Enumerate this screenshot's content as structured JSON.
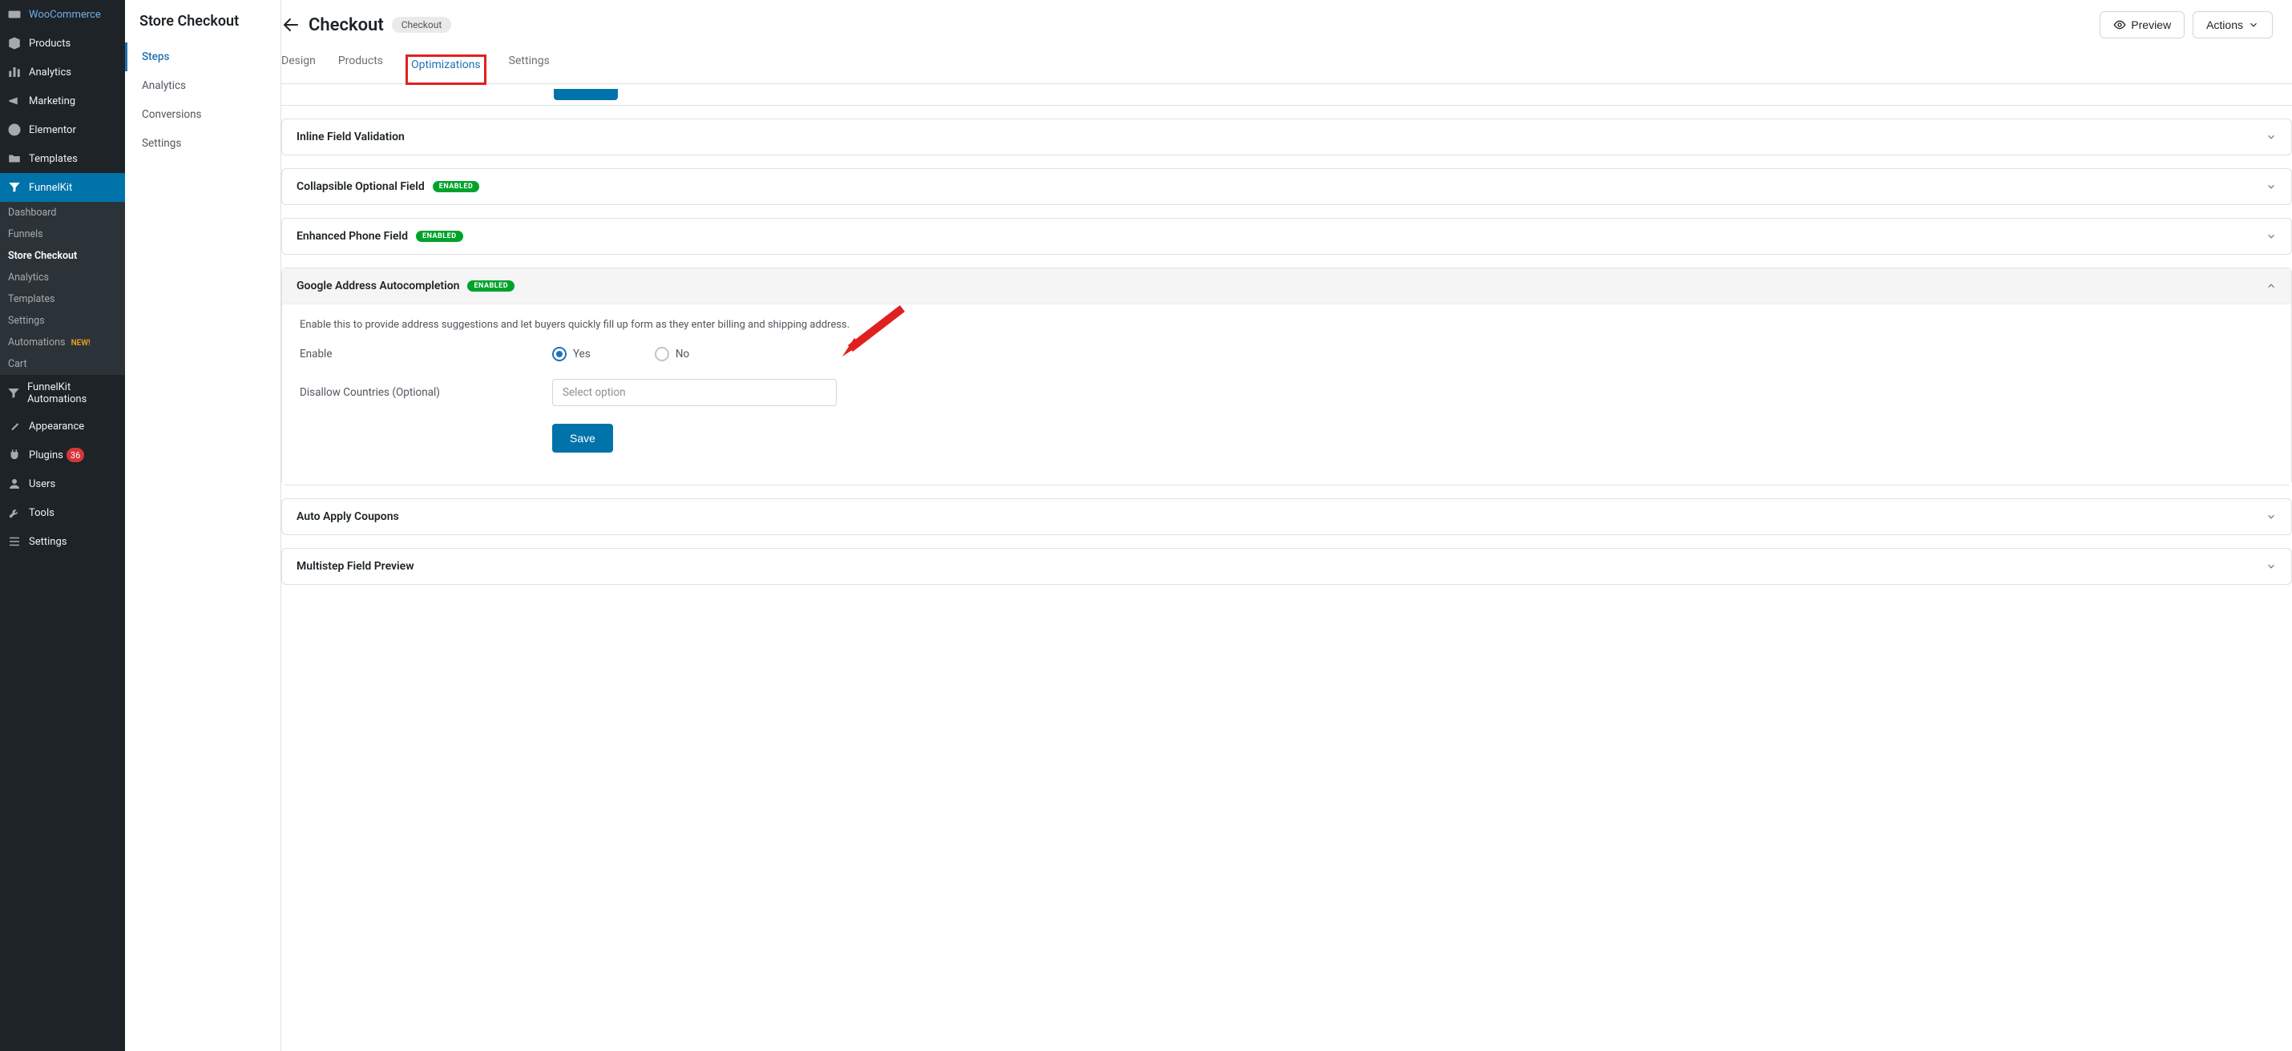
{
  "wpSidebar": {
    "items": [
      {
        "label": "WooCommerce",
        "icon": "woo"
      },
      {
        "label": "Products",
        "icon": "box"
      },
      {
        "label": "Analytics",
        "icon": "bars"
      },
      {
        "label": "Marketing",
        "icon": "megaphone"
      },
      {
        "label": "Elementor",
        "icon": "elementor"
      },
      {
        "label": "Templates",
        "icon": "folder"
      }
    ],
    "funnelkit": {
      "label": "FunnelKit",
      "sub": [
        {
          "label": "Dashboard"
        },
        {
          "label": "Funnels"
        },
        {
          "label": "Store Checkout",
          "current": true
        },
        {
          "label": "Analytics"
        },
        {
          "label": "Templates"
        },
        {
          "label": "Settings"
        },
        {
          "label": "Automations",
          "badge": "NEW!"
        },
        {
          "label": "Cart"
        }
      ]
    },
    "automations": {
      "label": "FunnelKit Automations"
    },
    "bottom": [
      {
        "label": "Appearance",
        "icon": "brush"
      },
      {
        "label": "Plugins",
        "icon": "plug",
        "count": "36"
      },
      {
        "label": "Users",
        "icon": "user"
      },
      {
        "label": "Tools",
        "icon": "wrench"
      },
      {
        "label": "Settings",
        "icon": "sliders"
      }
    ]
  },
  "secondarySidebar": {
    "title": "Store Checkout",
    "items": [
      {
        "label": "Steps",
        "active": true
      },
      {
        "label": "Analytics"
      },
      {
        "label": "Conversions"
      },
      {
        "label": "Settings"
      }
    ]
  },
  "topbar": {
    "title": "Checkout",
    "pill": "Checkout",
    "preview": "Preview",
    "actions": "Actions"
  },
  "tabs": [
    {
      "label": "Design"
    },
    {
      "label": "Products"
    },
    {
      "label": "Optimizations",
      "highlighted": true
    },
    {
      "label": "Settings"
    }
  ],
  "accordions": {
    "inlineValidation": {
      "title": "Inline Field Validation"
    },
    "collapsibleOptional": {
      "title": "Collapsible Optional Field",
      "enabled": "ENABLED"
    },
    "enhancedPhone": {
      "title": "Enhanced Phone Field",
      "enabled": "ENABLED"
    },
    "googleAddress": {
      "title": "Google Address Autocompletion",
      "enabled": "ENABLED",
      "desc": "Enable this to provide address suggestions and let buyers quickly fill up form as they enter billing and shipping address.",
      "enableLabel": "Enable",
      "yes": "Yes",
      "no": "No",
      "disallowLabel": "Disallow Countries (Optional)",
      "selectPlaceholder": "Select option",
      "saveLabel": "Save"
    },
    "autoApplyCoupons": {
      "title": "Auto Apply Coupons"
    },
    "multistepPreview": {
      "title": "Multistep Field Preview"
    }
  }
}
